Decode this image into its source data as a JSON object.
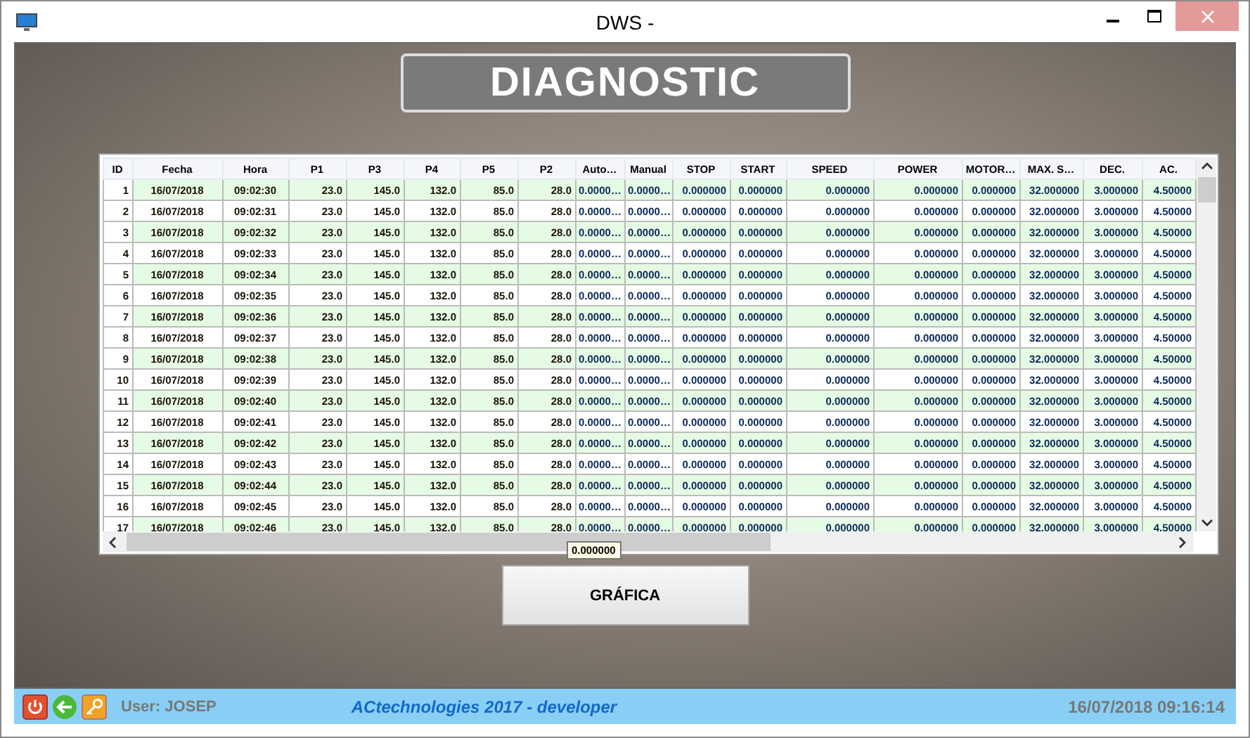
{
  "window": {
    "title": "DWS -"
  },
  "heading": "DIAGNOSTIC",
  "table": {
    "columns": [
      "ID",
      "Fecha",
      "Hora",
      "P1",
      "P3",
      "P4",
      "P5",
      "P2",
      "Auto…",
      "Manual",
      "STOP",
      "START",
      "SPEED",
      "POWER",
      "MOTOR…",
      "MAX. S…",
      "DEC.",
      "AC."
    ],
    "rows": [
      [
        "1",
        "16/07/2018",
        "09:02:30",
        "23.0",
        "145.0",
        "132.0",
        "85.0",
        "28.0",
        "0.0000…",
        "0.0000…",
        "0.000000",
        "0.000000",
        "0.000000",
        "0.000000",
        "0.000000",
        "32.000000",
        "3.000000",
        "4.50000"
      ],
      [
        "2",
        "16/07/2018",
        "09:02:31",
        "23.0",
        "145.0",
        "132.0",
        "85.0",
        "28.0",
        "0.0000…",
        "0.0000…",
        "0.000000",
        "0.000000",
        "0.000000",
        "0.000000",
        "0.000000",
        "32.000000",
        "3.000000",
        "4.50000"
      ],
      [
        "3",
        "16/07/2018",
        "09:02:32",
        "23.0",
        "145.0",
        "132.0",
        "85.0",
        "28.0",
        "0.0000…",
        "0.0000…",
        "0.000000",
        "0.000000",
        "0.000000",
        "0.000000",
        "0.000000",
        "32.000000",
        "3.000000",
        "4.50000"
      ],
      [
        "4",
        "16/07/2018",
        "09:02:33",
        "23.0",
        "145.0",
        "132.0",
        "85.0",
        "28.0",
        "0.0000…",
        "0.0000…",
        "0.000000",
        "0.000000",
        "0.000000",
        "0.000000",
        "0.000000",
        "32.000000",
        "3.000000",
        "4.50000"
      ],
      [
        "5",
        "16/07/2018",
        "09:02:34",
        "23.0",
        "145.0",
        "132.0",
        "85.0",
        "28.0",
        "0.0000…",
        "0.0000…",
        "0.000000",
        "0.000000",
        "0.000000",
        "0.000000",
        "0.000000",
        "32.000000",
        "3.000000",
        "4.50000"
      ],
      [
        "6",
        "16/07/2018",
        "09:02:35",
        "23.0",
        "145.0",
        "132.0",
        "85.0",
        "28.0",
        "0.0000…",
        "0.0000…",
        "0.000000",
        "0.000000",
        "0.000000",
        "0.000000",
        "0.000000",
        "32.000000",
        "3.000000",
        "4.50000"
      ],
      [
        "7",
        "16/07/2018",
        "09:02:36",
        "23.0",
        "145.0",
        "132.0",
        "85.0",
        "28.0",
        "0.0000…",
        "0.0000…",
        "0.000000",
        "0.000000",
        "0.000000",
        "0.000000",
        "0.000000",
        "32.000000",
        "3.000000",
        "4.50000"
      ],
      [
        "8",
        "16/07/2018",
        "09:02:37",
        "23.0",
        "145.0",
        "132.0",
        "85.0",
        "28.0",
        "0.0000…",
        "0.0000…",
        "0.000000",
        "0.000000",
        "0.000000",
        "0.000000",
        "0.000000",
        "32.000000",
        "3.000000",
        "4.50000"
      ],
      [
        "9",
        "16/07/2018",
        "09:02:38",
        "23.0",
        "145.0",
        "132.0",
        "85.0",
        "28.0",
        "0.0000…",
        "0.0000…",
        "0.000000",
        "0.000000",
        "0.000000",
        "0.000000",
        "0.000000",
        "32.000000",
        "3.000000",
        "4.50000"
      ],
      [
        "10",
        "16/07/2018",
        "09:02:39",
        "23.0",
        "145.0",
        "132.0",
        "85.0",
        "28.0",
        "0.0000…",
        "0.0000…",
        "0.000000",
        "0.000000",
        "0.000000",
        "0.000000",
        "0.000000",
        "32.000000",
        "3.000000",
        "4.50000"
      ],
      [
        "11",
        "16/07/2018",
        "09:02:40",
        "23.0",
        "145.0",
        "132.0",
        "85.0",
        "28.0",
        "0.0000…",
        "0.0000…",
        "0.000000",
        "0.000000",
        "0.000000",
        "0.000000",
        "0.000000",
        "32.000000",
        "3.000000",
        "4.50000"
      ],
      [
        "12",
        "16/07/2018",
        "09:02:41",
        "23.0",
        "145.0",
        "132.0",
        "85.0",
        "28.0",
        "0.0000…",
        "0.0000…",
        "0.000000",
        "0.000000",
        "0.000000",
        "0.000000",
        "0.000000",
        "32.000000",
        "3.000000",
        "4.50000"
      ],
      [
        "13",
        "16/07/2018",
        "09:02:42",
        "23.0",
        "145.0",
        "132.0",
        "85.0",
        "28.0",
        "0.0000…",
        "0.0000…",
        "0.000000",
        "0.000000",
        "0.000000",
        "0.000000",
        "0.000000",
        "32.000000",
        "3.000000",
        "4.50000"
      ],
      [
        "14",
        "16/07/2018",
        "09:02:43",
        "23.0",
        "145.0",
        "132.0",
        "85.0",
        "28.0",
        "0.0000…",
        "0.0000…",
        "0.000000",
        "0.000000",
        "0.000000",
        "0.000000",
        "0.000000",
        "32.000000",
        "3.000000",
        "4.50000"
      ],
      [
        "15",
        "16/07/2018",
        "09:02:44",
        "23.0",
        "145.0",
        "132.0",
        "85.0",
        "28.0",
        "0.0000…",
        "0.0000…",
        "0.000000",
        "0.000000",
        "0.000000",
        "0.000000",
        "0.000000",
        "32.000000",
        "3.000000",
        "4.50000"
      ],
      [
        "16",
        "16/07/2018",
        "09:02:45",
        "23.0",
        "145.0",
        "132.0",
        "85.0",
        "28.0",
        "0.0000…",
        "0.0000…",
        "0.000000",
        "0.000000",
        "0.000000",
        "0.000000",
        "0.000000",
        "32.000000",
        "3.000000",
        "4.50000"
      ],
      [
        "17",
        "16/07/2018",
        "09:02:46",
        "23.0",
        "145.0",
        "132.0",
        "85.0",
        "28.0",
        "0.0000…",
        "0.0000…",
        "0.000000",
        "0.000000",
        "0.000000",
        "0.000000",
        "0.000000",
        "32.000000",
        "3.000000",
        "4.50000"
      ]
    ]
  },
  "tooltip": "0.000000",
  "chart_button": "GRÁFICA",
  "status_bar": {
    "user": "User: JOSEP",
    "center": "ACtechnologies 2017 - developer",
    "datetime": "16/07/2018 09:16:14"
  }
}
